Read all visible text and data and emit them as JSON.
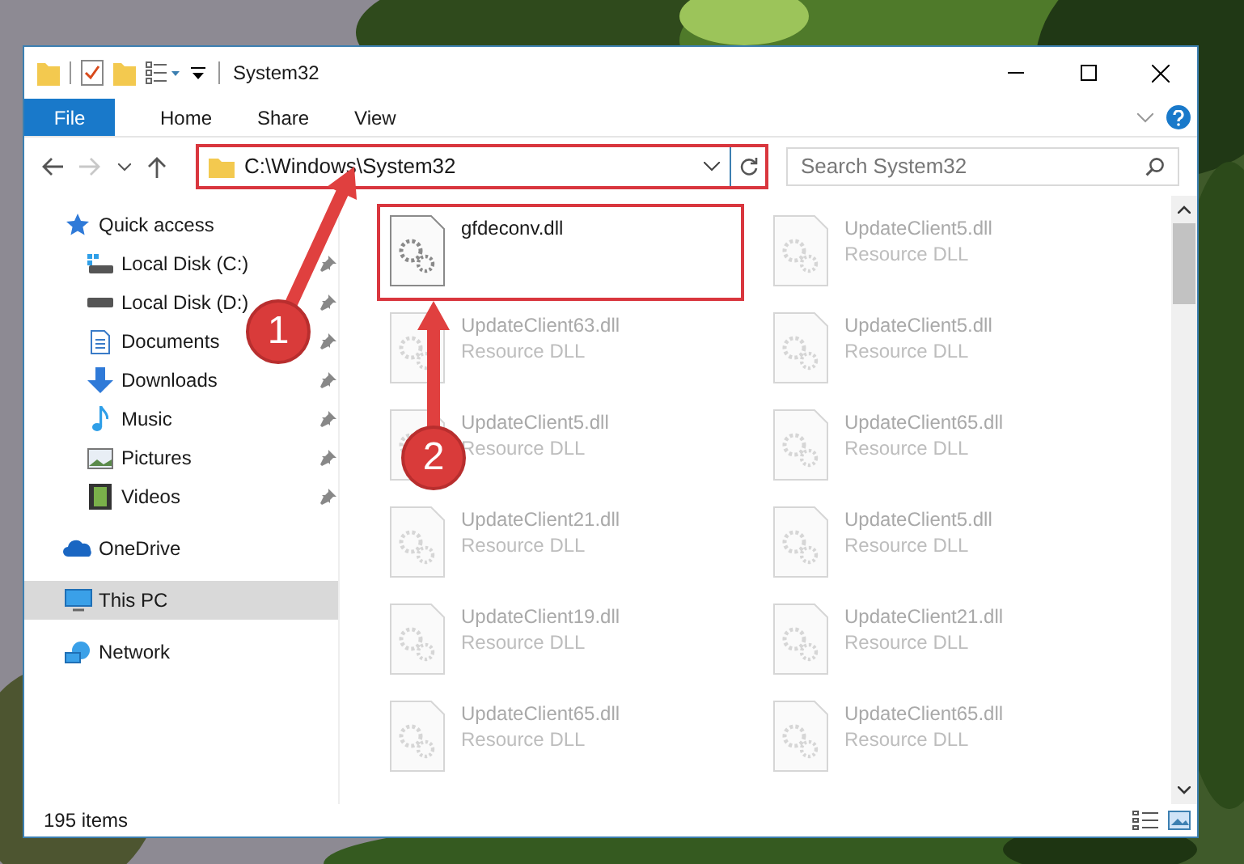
{
  "window": {
    "title": "System32"
  },
  "file_button": "File",
  "ribbon_tabs": [
    "Home",
    "Share",
    "View"
  ],
  "address_bar": {
    "path": "C:\\Windows\\System32",
    "highlighted": true
  },
  "search": {
    "placeholder": "Search System32"
  },
  "sidebar": {
    "items": [
      {
        "label": "Quick access",
        "selected": false,
        "children": [
          {
            "label": "Local Disk (C:)",
            "pinned": true,
            "selected": false
          },
          {
            "label": "Local Disk (D:)",
            "pinned": true,
            "selected": false
          },
          {
            "label": "Documents",
            "pinned": true,
            "selected": false
          },
          {
            "label": "Downloads",
            "pinned": true,
            "selected": false
          },
          {
            "label": "Music",
            "pinned": true,
            "selected": false
          },
          {
            "label": "Pictures",
            "pinned": true,
            "selected": false
          },
          {
            "label": "Videos",
            "pinned": true,
            "selected": false
          }
        ]
      },
      {
        "label": "OneDrive",
        "selected": false
      },
      {
        "label": "This PC",
        "selected": true
      },
      {
        "label": "Network",
        "selected": false
      }
    ]
  },
  "files": [
    {
      "name": "gfdeconv.dll",
      "highlighted": true
    },
    {
      "name": "UpdateClient5.dll",
      "type": "Resource DLL",
      "highlighted": false
    },
    {
      "name": "UpdateClient63.dll",
      "type": "Resource DLL",
      "highlighted": false
    },
    {
      "name": "UpdateClient5.dll",
      "type": "Resource DLL",
      "highlighted": false
    },
    {
      "name": "UpdateClient5.dll",
      "type": "Resource DLL",
      "highlighted": false
    },
    {
      "name": "UpdateClient65.dll",
      "type": "Resource DLL",
      "highlighted": false
    },
    {
      "name": "UpdateClient21.dll",
      "type": "Resource DLL",
      "highlighted": false
    },
    {
      "name": "UpdateClient5.dll",
      "type": "Resource DLL",
      "highlighted": false
    },
    {
      "name": "UpdateClient19.dll",
      "type": "Resource DLL",
      "highlighted": false
    },
    {
      "name": "UpdateClient21.dll",
      "type": "Resource DLL",
      "highlighted": false
    },
    {
      "name": "UpdateClient65.dll",
      "type": "Resource DLL",
      "highlighted": false
    },
    {
      "name": "UpdateClient65.dll",
      "type": "Resource DLL",
      "highlighted": false
    }
  ],
  "status_bar": {
    "item_count": "195 items"
  },
  "annotations": [
    {
      "label": "1"
    },
    {
      "label": "2"
    }
  ]
}
